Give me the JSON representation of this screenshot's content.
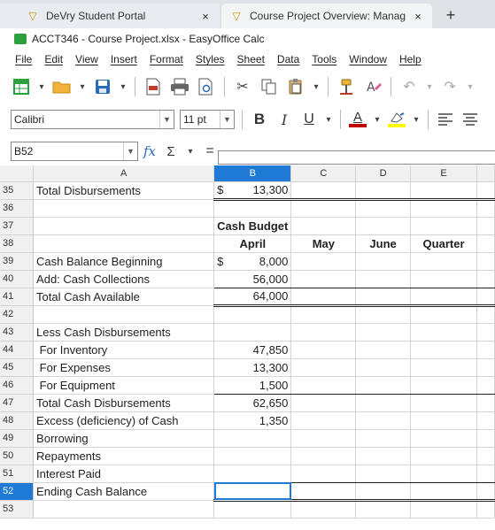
{
  "browser": {
    "tabs": [
      {
        "title": "DeVry Student Portal",
        "close": "×"
      },
      {
        "title": "Course Project Overview: Manag",
        "close": "×"
      }
    ],
    "new_tab": "+"
  },
  "app": {
    "title": "ACCT346 - Course Project.xlsx - EasyOffice Calc"
  },
  "menu": [
    "File",
    "Edit",
    "View",
    "Insert",
    "Format",
    "Styles",
    "Sheet",
    "Data",
    "Tools",
    "Window",
    "Help"
  ],
  "toolbar": {
    "icons": [
      "spreadsheet-icon",
      "open-folder-icon",
      "save-icon",
      "export-pdf-icon",
      "print-icon",
      "print-preview-icon",
      "cut-icon",
      "copy-icon",
      "paste-icon",
      "clone-format-icon",
      "clear-format-icon",
      "undo-icon",
      "redo-icon"
    ]
  },
  "format": {
    "font_name": "Calibri",
    "font_size": "11 pt",
    "bold": "B",
    "italic": "I",
    "underline": "U",
    "font_color_glyph": "A",
    "font_color": "#c00000",
    "highlight_color": "#ffff00"
  },
  "formula": {
    "name_box": "B52",
    "fx": "fx",
    "sigma": "Σ",
    "equals": "=",
    "content": ""
  },
  "sheet": {
    "columns": [
      "A",
      "B",
      "C",
      "D",
      "E"
    ],
    "selected_column": "B",
    "selected_row": "52",
    "rows": [
      {
        "n": "35",
        "a": "Total Disbursements",
        "b_sym": "$",
        "b": "13,300",
        "c": "",
        "d": "",
        "e": ""
      },
      {
        "n": "36",
        "a": "",
        "b_sym": "",
        "b": "",
        "c": "",
        "d": "",
        "e": ""
      },
      {
        "n": "37",
        "a": "",
        "b_sym": "",
        "b": "Cash Budget",
        "c": "",
        "d": "",
        "e": ""
      },
      {
        "n": "38",
        "a": "",
        "b_sym": "",
        "b": "April",
        "c": "May",
        "d": "June",
        "e": "Quarter"
      },
      {
        "n": "39",
        "a": "Cash Balance Beginning",
        "b_sym": "$",
        "b": "8,000",
        "c": "",
        "d": "",
        "e": ""
      },
      {
        "n": "40",
        "a": "Add: Cash Collections",
        "b_sym": "",
        "b": "56,000",
        "c": "",
        "d": "",
        "e": ""
      },
      {
        "n": "41",
        "a": "Total Cash Available",
        "b_sym": "",
        "b": "64,000",
        "c": "",
        "d": "",
        "e": ""
      },
      {
        "n": "42",
        "a": "",
        "b_sym": "",
        "b": "",
        "c": "",
        "d": "",
        "e": ""
      },
      {
        "n": "43",
        "a": "Less Cash Disbursements",
        "b_sym": "",
        "b": "",
        "c": "",
        "d": "",
        "e": ""
      },
      {
        "n": "44",
        "a": " For Inventory",
        "b_sym": "",
        "b": "47,850",
        "c": "",
        "d": "",
        "e": ""
      },
      {
        "n": "45",
        "a": " For Expenses",
        "b_sym": "",
        "b": "13,300",
        "c": "",
        "d": "",
        "e": ""
      },
      {
        "n": "46",
        "a": " For Equipment",
        "b_sym": "",
        "b": "1,500",
        "c": "",
        "d": "",
        "e": ""
      },
      {
        "n": "47",
        "a": "Total Cash Disbursements",
        "b_sym": "",
        "b": "62,650",
        "c": "",
        "d": "",
        "e": ""
      },
      {
        "n": "48",
        "a": "Excess (deficiency) of Cash",
        "b_sym": "",
        "b": "1,350",
        "c": "",
        "d": "",
        "e": ""
      },
      {
        "n": "49",
        "a": "Borrowing",
        "b_sym": "",
        "b": "",
        "c": "",
        "d": "",
        "e": ""
      },
      {
        "n": "50",
        "a": "Repayments",
        "b_sym": "",
        "b": "",
        "c": "",
        "d": "",
        "e": ""
      },
      {
        "n": "51",
        "a": "Interest Paid",
        "b_sym": "",
        "b": "",
        "c": "",
        "d": "",
        "e": ""
      },
      {
        "n": "52",
        "a": "Ending Cash Balance",
        "b_sym": "",
        "b": "",
        "c": "",
        "d": "",
        "e": ""
      },
      {
        "n": "53",
        "a": "",
        "b_sym": "",
        "b": "",
        "c": "",
        "d": "",
        "e": ""
      }
    ]
  }
}
